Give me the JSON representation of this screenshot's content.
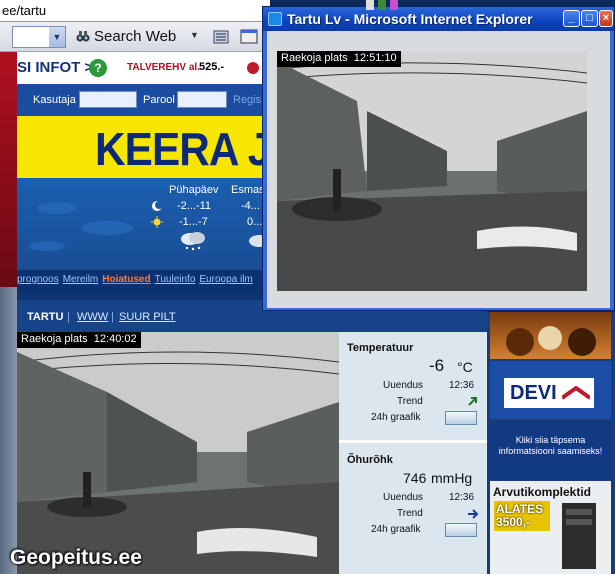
{
  "address_bar": {
    "url": "ee/tartu"
  },
  "toolbar": {
    "search_label": "Search Web"
  },
  "infobar": {
    "title": "SI INFOT >",
    "help_icon": "?",
    "talve_label": "TALVEREHV al.",
    "price": "525.-"
  },
  "login": {
    "user_label": "Kasutaja",
    "password_label": "Parool",
    "register_label": "Regis"
  },
  "banner": {
    "text": "KEERA JA"
  },
  "forecast": {
    "days": [
      {
        "name": "Pühapäev",
        "night": "-2...-11",
        "day": "-1...-7"
      },
      {
        "name": "Esmas",
        "night": "-4...",
        "day": "0..."
      }
    ]
  },
  "links": [
    {
      "label": "prognoos"
    },
    {
      "label": "Mereilm"
    },
    {
      "label": "Hoiatused"
    },
    {
      "label": "Tuuleinfo"
    },
    {
      "label": "Euroopa ilm"
    }
  ],
  "tartu_header": {
    "city": "TARTU",
    "separator": "|",
    "www": "WWW",
    "big_image": "SUUR PILT"
  },
  "cam_bottom": {
    "location": "Raekoja plats",
    "time": "12:40:02"
  },
  "weather_panel": {
    "temp_title": "Temperatuur",
    "temp_value": "-6",
    "temp_unit": "°C",
    "temp_updated_label": "Uuendus",
    "temp_updated_time": "12:36",
    "temp_trend_label": "Trend",
    "temp_graph_label": "24h graafik",
    "pressure_title": "Õhurõhk",
    "pressure_value": "746",
    "pressure_unit": "mmHg",
    "pressure_updated_label": "Uuendus",
    "pressure_updated_time": "12:36",
    "pressure_trend_label": "Trend",
    "pressure_graph_label": "24h graafik"
  },
  "ads": {
    "devi": "DEVI",
    "info_text": "Kliki siia täpsema informatsiooni saamiseks!",
    "computer_title": "Arvutikomplektid",
    "computer_price_line1": "ALATES",
    "computer_price_line2": "3500,-"
  },
  "popup": {
    "title": "Tartu Lv - Microsoft Internet Explorer",
    "minimize": "_",
    "maximize": "□",
    "close": "×",
    "cam_location": "Raekoja plats",
    "cam_time": "12:51:10"
  },
  "watermark": {
    "text": "Geopeitus.ee"
  },
  "colors": {
    "banner_yellow": "#f7e600",
    "link_highlight": "#ff7a3a",
    "xp_title_blue": "#0c44c0"
  }
}
